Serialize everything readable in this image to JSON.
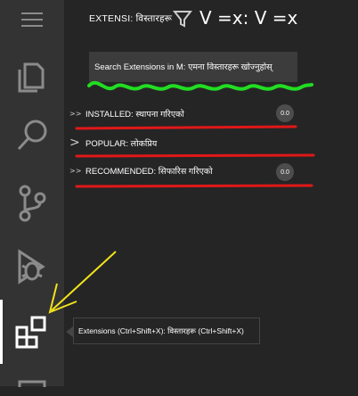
{
  "activity_bar": {
    "items": [
      {
        "icon": "hamburger-menu-icon"
      },
      {
        "icon": "explorer-files-icon"
      },
      {
        "icon": "search-icon"
      },
      {
        "icon": "source-control-icon"
      },
      {
        "icon": "run-debug-icon"
      },
      {
        "icon": "extensions-icon",
        "active": true
      },
      {
        "icon": "remote-explorer-icon"
      }
    ]
  },
  "sidebar": {
    "header_title": "EXTENSI: विस्तारहरू",
    "header_extra": "V =x: V =x",
    "filter_icon": "filter-icon",
    "search": {
      "placeholder": "Search Extensions in M: एमना विस्तारहरू खोज्नुहोस्"
    },
    "sections": [
      {
        "chevron": ">>",
        "label": "INSTALLED: स्थापना गरिएको",
        "badge": "0.0"
      },
      {
        "chevron": ">",
        "label": "POPULAR: लोकप्रिय"
      },
      {
        "chevron": ">>",
        "label": "RECOMMENDED: सिफारिस गरिएको",
        "badge": "0.0"
      }
    ]
  },
  "tooltip": {
    "text": "Extensions (Ctrl+Shift+X): विस्तारहरू (Ctrl+Shift+X)"
  },
  "colors": {
    "activity_bar": "#333333",
    "sidebar": "#252526",
    "search_box": "#3c3c3c",
    "annotation_green": "#22dd22",
    "annotation_red": "#e01818",
    "annotation_yellow": "#f2e21a"
  }
}
